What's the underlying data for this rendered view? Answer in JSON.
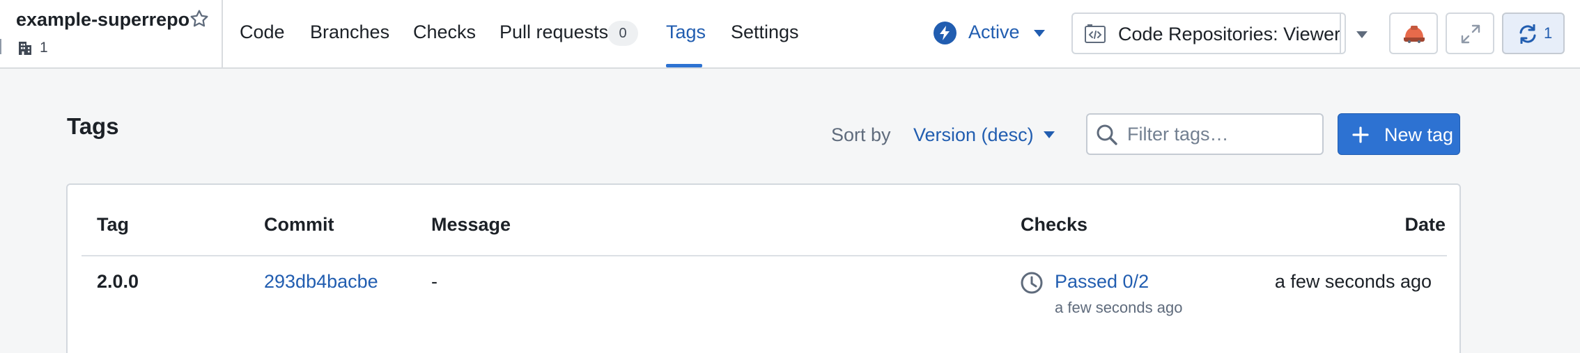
{
  "repo": {
    "name": "example-superrepo",
    "org_count": "1"
  },
  "nav": {
    "tabs": [
      {
        "label": "Code"
      },
      {
        "label": "Branches"
      },
      {
        "label": "Checks"
      },
      {
        "label": "Pull requests",
        "badge": "0"
      },
      {
        "label": "Tags",
        "active": true
      },
      {
        "label": "Settings"
      }
    ]
  },
  "status": {
    "label": "Active"
  },
  "role": {
    "label": "Code Repositories: Viewer"
  },
  "sync": {
    "count": "1"
  },
  "toolbar": {
    "title": "Tags",
    "sort_label": "Sort by",
    "sort_value": "Version (desc)",
    "filter_placeholder": "Filter tags…",
    "filter_value": "",
    "new_tag_label": "New tag"
  },
  "table": {
    "columns": {
      "tag": "Tag",
      "commit": "Commit",
      "message": "Message",
      "checks": "Checks",
      "date": "Date"
    },
    "rows": [
      {
        "tag": "2.0.0",
        "commit": "293db4bacbe",
        "message": "-",
        "checks_status": "Passed 0/2",
        "checks_time": "a few seconds ago",
        "date": "a few seconds ago"
      }
    ]
  },
  "colors": {
    "accent": "#2d72d2",
    "link": "#215db0",
    "border": "#d3d8de",
    "background": "#f5f6f7"
  },
  "icons": [
    "star-icon",
    "building-icon",
    "bolt-icon",
    "chevron-down-icon",
    "code-box-icon",
    "hardhat-icon",
    "expand-icon",
    "sync-icon",
    "search-icon",
    "plus-icon",
    "clock-icon"
  ]
}
